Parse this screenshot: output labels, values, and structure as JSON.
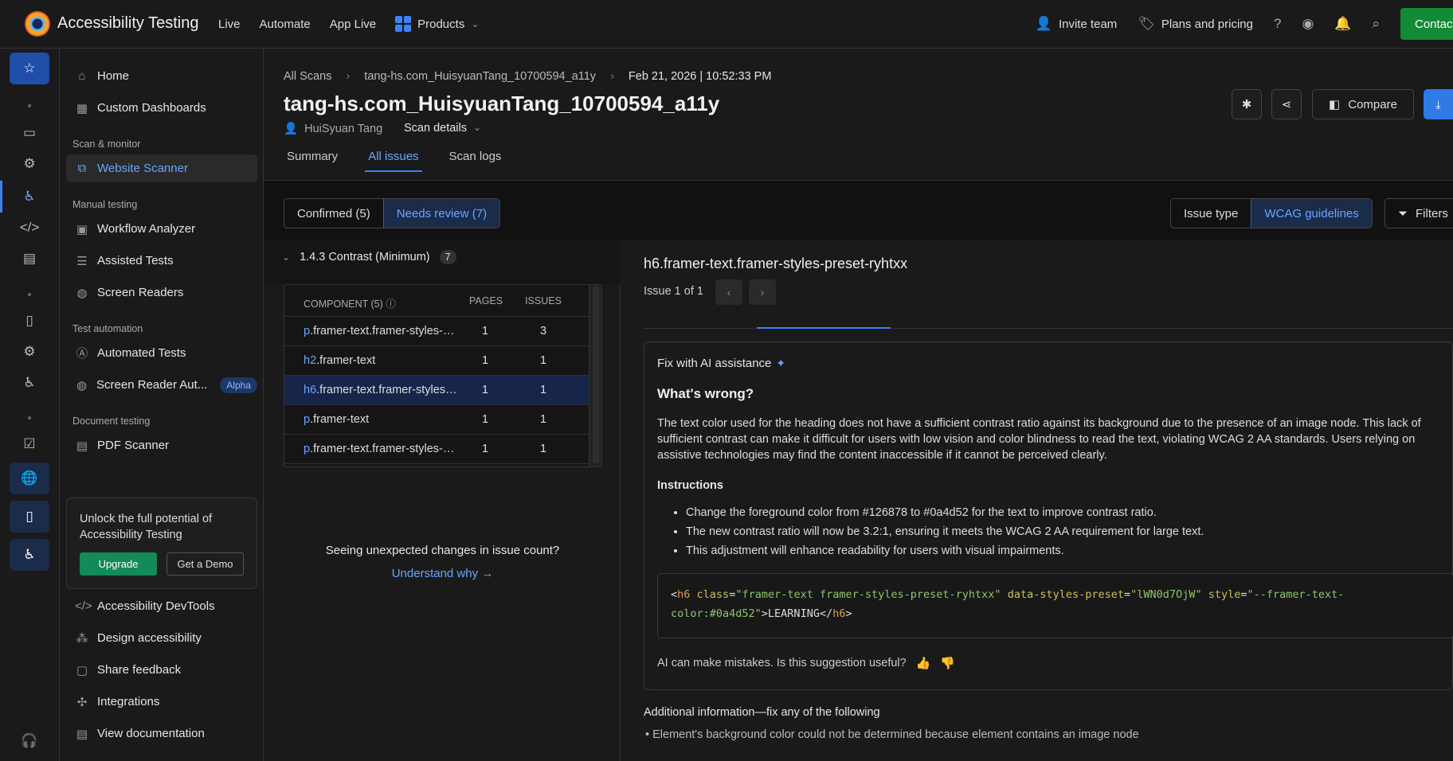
{
  "app": {
    "title": "Accessibility Testing"
  },
  "topnav": {
    "live": "Live",
    "automate": "Automate",
    "app_live": "App Live",
    "products": "Products"
  },
  "topright": {
    "invite": "Invite team",
    "plans": "Plans and pricing",
    "contact": "Contact"
  },
  "sidebar": {
    "home": "Home",
    "custom_dashboards": "Custom Dashboards",
    "sec_scan": "Scan & monitor",
    "website_scanner": "Website Scanner",
    "sec_manual": "Manual testing",
    "workflow_analyzer": "Workflow Analyzer",
    "assisted_tests": "Assisted Tests",
    "screen_readers": "Screen Readers",
    "sec_automation": "Test automation",
    "automated_tests": "Automated Tests",
    "screen_reader_auto": "Screen Reader Aut...",
    "alpha": "Alpha",
    "sec_document": "Document testing",
    "pdf_scanner": "PDF Scanner",
    "upsell_text": "Unlock the full potential of Accessibility Testing",
    "upgrade": "Upgrade",
    "get_demo": "Get a Demo",
    "devtools": "Accessibility DevTools",
    "design_accessibility": "Design accessibility",
    "share_feedback": "Share feedback",
    "integrations": "Integrations",
    "view_documentation": "View documentation"
  },
  "breadcrumb": {
    "all_scans": "All Scans",
    "scan_name": "tang-hs.com_HuisyuanTang_10700594_a11y",
    "date": "Feb 21, 2026 | 10:52:33 PM"
  },
  "page": {
    "title": "tang-hs.com_HuisyuanTang_10700594_a11y",
    "owner": "HuiSyuan Tang",
    "scan_details": "Scan details",
    "compare": "Compare"
  },
  "tabs": {
    "summary": "Summary",
    "all_issues": "All issues",
    "scan_logs": "Scan logs"
  },
  "filters": {
    "confirmed": "Confirmed (5)",
    "needs_review": "Needs review (7)",
    "issue_type": "Issue type",
    "wcag": "WCAG guidelines",
    "filters": "Filters"
  },
  "group": {
    "title": "1.4.3 Contrast (Minimum)",
    "count": "7"
  },
  "components": {
    "header": {
      "component": "COMPONENT (5)",
      "pages": "PAGES",
      "issues": "ISSUES"
    },
    "rows": [
      {
        "tag": "p",
        "rest": ".framer-text.framer-styles-preset",
        "pages": "1",
        "issues": "3"
      },
      {
        "tag": "h2",
        "rest": ".framer-text",
        "pages": "1",
        "issues": "1"
      },
      {
        "tag": "h6",
        "rest": ".framer-text.framer-styles-preset-ryhtxx",
        "pages": "1",
        "issues": "1"
      },
      {
        "tag": "p",
        "rest": ".framer-text",
        "pages": "1",
        "issues": "1"
      },
      {
        "tag": "p",
        "rest": ".framer-text.framer-styles-preset",
        "pages": "1",
        "issues": "1"
      }
    ]
  },
  "notice": {
    "text": "Seeing unexpected changes in issue count?",
    "link": "Understand why →"
  },
  "issue": {
    "title": "h6.framer-text.framer-styles-preset-ryhtxx",
    "count": "Issue 1 of 1",
    "ai_heading": "Fix with AI assistance",
    "whats_wrong": "What's wrong?",
    "description": "The text color used for the heading does not have a sufficient contrast ratio against its background due to the presence of an image node. This lack of sufficient contrast can make it difficult for users with low vision and color blindness to read the text, violating WCAG 2 AA standards. Users relying on assistive technologies may find the content inaccessible if it cannot be perceived clearly.",
    "instructions_label": "Instructions",
    "instructions": [
      "Change the foreground color from #126878 to #0a4d52 for the text to improve contrast ratio.",
      "The new contrast ratio will now be 3.2:1, ensuring it meets the WCAG 2 AA requirement for large text.",
      "This adjustment will enhance readability for users with visual impairments."
    ],
    "code": {
      "open": "<",
      "tag": "h6",
      "a1": "class",
      "v1": "\"framer-text framer-styles-preset-ryhtxx\"",
      "a2": "data-styles-preset",
      "v2": "\"lWN0d7OjW\"",
      "a3": "style",
      "v3a": "\"--framer-text-",
      "v3b": "color:#0a4d52\"",
      "content": ">LEARNING</",
      "close_tag": "h6",
      "end": ">"
    },
    "feedback": "AI can make mistakes. Is this suggestion useful?",
    "additional": "Additional information—fix any of the following",
    "additional_item": "Element's background color could not be determined because element contains an image node"
  },
  "colors": {
    "accent": "#3b82f6",
    "link": "#6aa6ff",
    "upgrade": "#138a57",
    "contact": "#138a36"
  }
}
